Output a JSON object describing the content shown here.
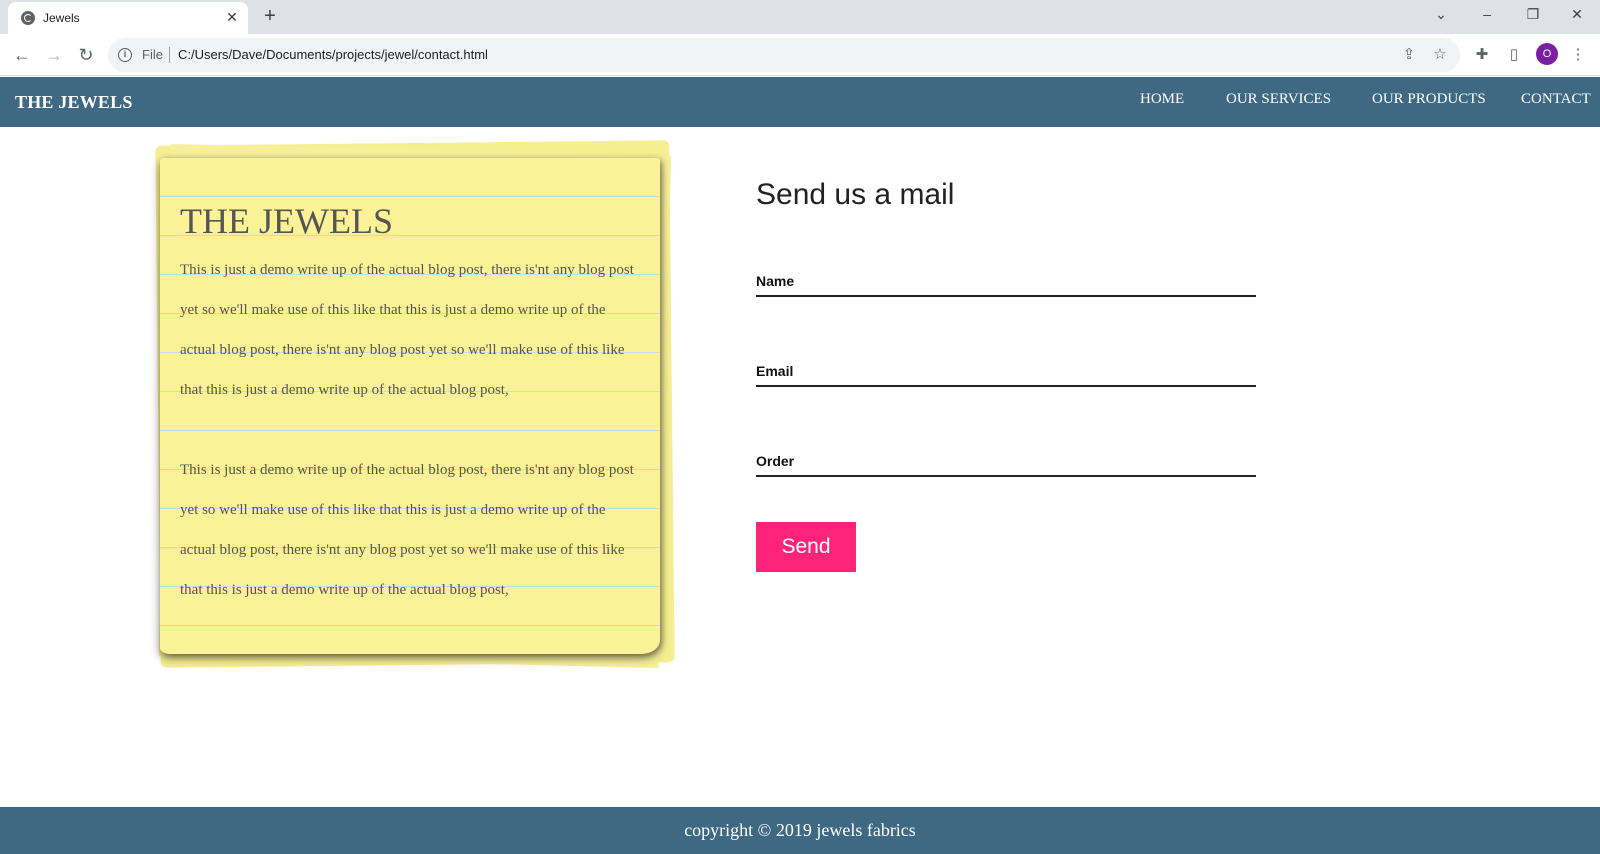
{
  "browser": {
    "tab_title": "Jewels",
    "url_scheme": "File",
    "url": "C:/Users/Dave/Documents/projects/jewel/contact.html",
    "avatar_initial": "O"
  },
  "site": {
    "brand": "THE JEWELS",
    "nav": [
      "HOME",
      "OUR SERVICES",
      "OUR PRODUCTS",
      "CONTACT"
    ],
    "header_color": "#3f6883"
  },
  "note": {
    "title": "THE JEWELS",
    "paragraphs": [
      "This is just a demo write up of the actual blog post, there is'nt any blog post yet so we'll make use of this like that this is just a demo write up of the actual blog post, there is'nt any blog post yet so we'll make use of this like that this is just a demo write up of the actual blog post,",
      "This is just a demo write up of the actual blog post, there is'nt any blog post yet so we'll make use of this like that this is just a demo write up of the actual blog post, there is'nt any blog post yet so we'll make use of this like that this is just a demo write up of the actual blog post,"
    ],
    "color": "#fbf297"
  },
  "form": {
    "title": "Send us a mail",
    "fields": [
      "Name",
      "Email",
      "Order"
    ],
    "submit_label": "Send",
    "button_color": "#ff2479"
  },
  "footer": {
    "text": "copyright © 2019 jewels fabrics"
  }
}
